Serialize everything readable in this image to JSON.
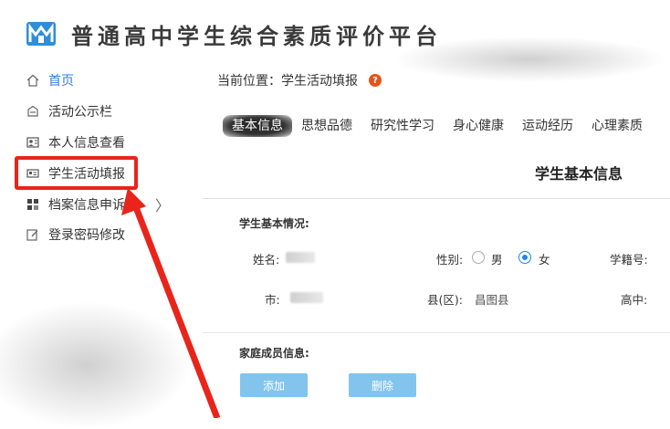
{
  "header": {
    "app_title": "普通高中学生综合素质评价平台",
    "logo_icon": "logo-icon"
  },
  "sidebar": {
    "items": [
      {
        "label": "首页",
        "icon": "home-icon",
        "active": true
      },
      {
        "label": "活动公示栏",
        "icon": "bulletin-icon"
      },
      {
        "label": "本人信息查看",
        "icon": "id-card-icon"
      },
      {
        "label": "学生活动填报",
        "icon": "form-card-icon"
      },
      {
        "label": "档案信息申诉",
        "icon": "grid-icon"
      },
      {
        "label": "登录密码修改",
        "icon": "edit-icon"
      }
    ],
    "expand_glyph": "〉"
  },
  "breadcrumb": {
    "text": "当前位置：学生活动填报",
    "help_glyph": "?"
  },
  "tabs": [
    "基本信息",
    "思想品德",
    "研究性学习",
    "身心健康",
    "运动经历",
    "心理素质"
  ],
  "active_tab": 0,
  "basic_info": {
    "title": "学生基本信息",
    "section_label": "学生基本情况:",
    "name_label": "姓名:",
    "gender_label": "性别:",
    "gender_male": "男",
    "gender_female": "女",
    "gender_selected": "女",
    "student_id_label": "学籍号:",
    "city_label": "市:",
    "county_label": "县(区):",
    "county_value": "昌图县",
    "high_school_label": "高中:"
  },
  "family": {
    "section_label": "家庭成员信息:",
    "add_button": "添加",
    "delete_button": "删除"
  },
  "colors": {
    "accent": "#2f7fd6",
    "highlight": "#e8241b",
    "button": "#82c4ec",
    "help": "#e45318"
  }
}
